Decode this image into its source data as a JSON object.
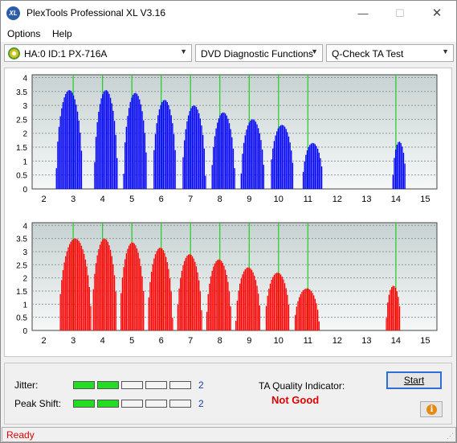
{
  "window": {
    "title": "PlexTools Professional XL V3.16",
    "app_icon_text": "XL"
  },
  "titlebar_buttons": {
    "minimize": "—",
    "maximize": "☐",
    "close": "✕"
  },
  "menu": {
    "options": "Options",
    "help": "Help"
  },
  "toolbar": {
    "drive": "HA:0 ID:1  PX-716A",
    "function": "DVD Diagnostic Functions",
    "test": "Q-Check TA Test"
  },
  "chart_data": [
    {
      "type": "bar",
      "series_color": "#0000ff",
      "x_ticks": [
        "2",
        "3",
        "4",
        "5",
        "6",
        "7",
        "8",
        "9",
        "10",
        "11",
        "12",
        "13",
        "14",
        "15"
      ],
      "y_ticks": [
        "0",
        "0.5",
        "1",
        "1.5",
        "2",
        "2.5",
        "3",
        "3.5",
        "4"
      ],
      "xlim": [
        1.6,
        15.4
      ],
      "ylim": [
        0,
        4.1
      ],
      "peaks": [
        {
          "center": 2.85,
          "height": 3.55,
          "width": 0.9
        },
        {
          "center": 4.1,
          "height": 3.55,
          "width": 0.8
        },
        {
          "center": 5.1,
          "height": 3.45,
          "width": 0.8
        },
        {
          "center": 6.1,
          "height": 3.2,
          "width": 0.8
        },
        {
          "center": 7.1,
          "height": 3.0,
          "width": 0.8
        },
        {
          "center": 8.1,
          "height": 2.75,
          "width": 0.8
        },
        {
          "center": 9.1,
          "height": 2.5,
          "width": 0.8
        },
        {
          "center": 10.1,
          "height": 2.3,
          "width": 0.8
        },
        {
          "center": 11.15,
          "height": 1.65,
          "width": 0.7
        },
        {
          "center": 14.1,
          "height": 1.7,
          "width": 0.45
        }
      ],
      "green_marks": [
        3,
        4,
        5,
        6,
        7,
        8,
        9,
        10,
        11,
        14
      ],
      "grid": true
    },
    {
      "type": "bar",
      "series_color": "#ff0000",
      "x_ticks": [
        "2",
        "3",
        "4",
        "5",
        "6",
        "7",
        "8",
        "9",
        "10",
        "11",
        "12",
        "13",
        "14",
        "15"
      ],
      "y_ticks": [
        "0",
        "0.5",
        "1",
        "1.5",
        "2",
        "2.5",
        "3",
        "3.5",
        "4"
      ],
      "xlim": [
        1.6,
        15.4
      ],
      "ylim": [
        0,
        4.1
      ],
      "peaks": [
        {
          "center": 3.05,
          "height": 3.5,
          "width": 1.1
        },
        {
          "center": 4.05,
          "height": 3.5,
          "width": 0.85
        },
        {
          "center": 5.0,
          "height": 3.35,
          "width": 0.85
        },
        {
          "center": 5.95,
          "height": 3.15,
          "width": 0.85
        },
        {
          "center": 6.95,
          "height": 2.9,
          "width": 0.85
        },
        {
          "center": 7.95,
          "height": 2.7,
          "width": 0.85
        },
        {
          "center": 8.95,
          "height": 2.4,
          "width": 0.85
        },
        {
          "center": 9.95,
          "height": 2.2,
          "width": 0.85
        },
        {
          "center": 10.95,
          "height": 1.6,
          "width": 0.85
        },
        {
          "center": 13.9,
          "height": 1.7,
          "width": 0.5
        }
      ],
      "green_marks": [
        3,
        4,
        5,
        6,
        7,
        8,
        9,
        10,
        11,
        14
      ],
      "grid": true
    }
  ],
  "metrics": {
    "jitter_label": "Jitter:",
    "jitter_value": "2",
    "jitter_level": 2,
    "peak_label": "Peak Shift:",
    "peak_value": "2",
    "peak_level": 2,
    "segments": 5
  },
  "ta": {
    "label": "TA Quality Indicator:",
    "result": "Not Good"
  },
  "buttons": {
    "start": "Start",
    "info_icon": "i"
  },
  "status": {
    "text": "Ready"
  }
}
